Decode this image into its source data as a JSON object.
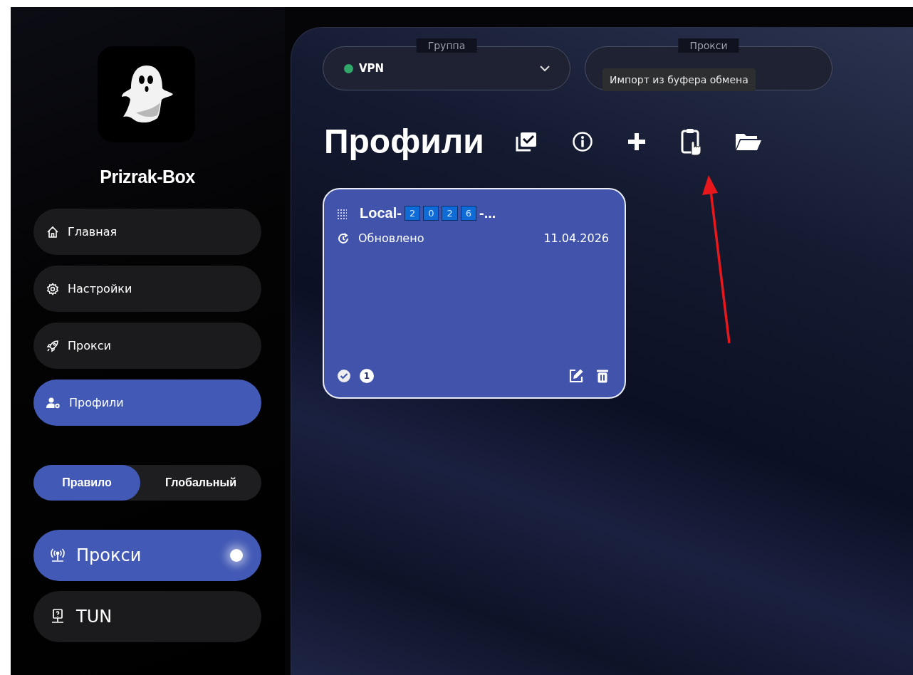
{
  "app": {
    "name": "Prizrak-Box"
  },
  "sidebar": {
    "items": [
      {
        "label": "Главная",
        "selected": false
      },
      {
        "label": "Настройки",
        "selected": false
      },
      {
        "label": "Прокси",
        "selected": false
      },
      {
        "label": "Профили",
        "selected": true
      }
    ]
  },
  "mode": [
    {
      "label": "Правило",
      "selected": true
    },
    {
      "label": "Глобальный",
      "selected": false
    }
  ],
  "toggles": [
    {
      "label": "Прокси",
      "on": true
    },
    {
      "label": "TUN",
      "on": false
    }
  ],
  "selectors": [
    {
      "label": "Группа",
      "value": "VPN",
      "color": "#2fa86a"
    },
    {
      "label": "Прокси"
    }
  ],
  "page_title": "Профили",
  "tooltip": "Импорт из буфера обмена",
  "profiles": [
    {
      "title_prefix": "Local-",
      "title_digits": [
        "2",
        "0",
        "2",
        "6"
      ],
      "title_suffix": "-...",
      "updated_label": "Обновлено",
      "updated_date": "11.04.2026",
      "selected": true,
      "count": "1"
    }
  ]
}
